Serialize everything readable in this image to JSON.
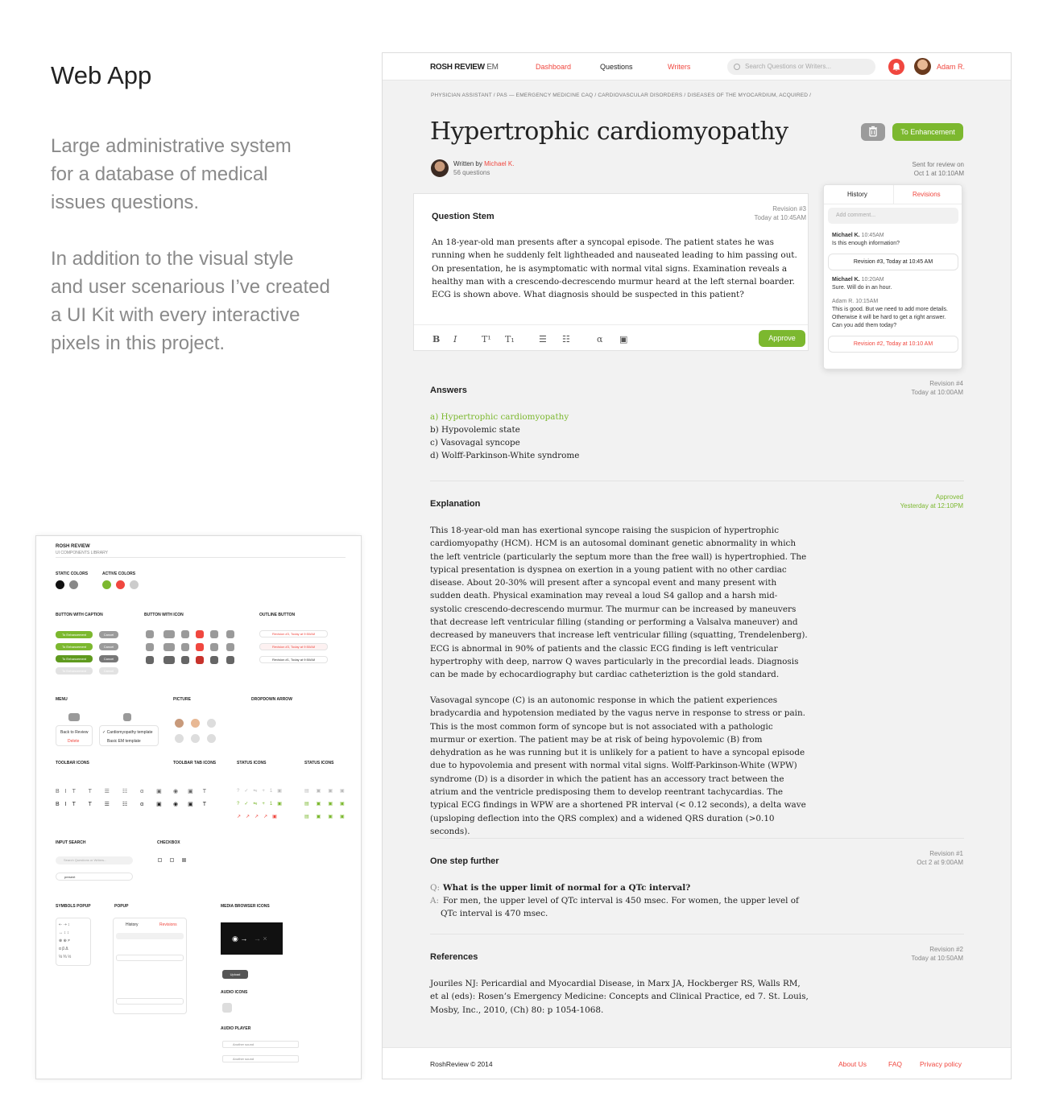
{
  "left": {
    "title": "Web App",
    "para1": "Large administrative system\nfor a database of medical\nissues questions.",
    "para2": "In addition to the visual style\nand user scenarious I’ve created\na UI Kit with every interactive\npixels in this project."
  },
  "uikit": {
    "title": "ROSH REVIEW",
    "subtitle": "UI COMPONENTS LIBRARY",
    "sections": [
      "STATIC COLORS",
      "ACTIVE COLORS",
      "BUTTON WITH CAPTION",
      "BUTTON WITH ICON",
      "OUTLINE BUTTON",
      "MENU",
      "PICTURE",
      "DROPDOWN ARROW",
      "TOOLBAR ICONS",
      "TOOLBAR TAB ICONS",
      "STATUS ICONS",
      "STATUS ICONS",
      "INPUT SEARCH",
      "CHECKBOX",
      "SYMBOLS POPUP",
      "POPUP",
      "MEDIA BROWSER ICONS",
      "AUDIO ICONS",
      "AUDIO PLAYER"
    ],
    "btn_enh": "To Enhancement",
    "btn_cancel": "Cancel",
    "outline1": "Revision #3, Today at 9:50AM",
    "outline2": "Revision #1, Today at 9:50AM",
    "menu_item1": "Back to Review",
    "menu_item2": "Delete",
    "menu_item3": "✓ Cardiomyopathy template",
    "menu_item4": "Basic EM template",
    "search_placeholder": "Search Questions or Writers...",
    "search_value": "present",
    "upload": "Upload",
    "audio1": "Another sound",
    "audio2": "Another sound",
    "popup_tab1": "History",
    "popup_tab2": "Revisions",
    "static_colors": [
      "#111111",
      "#888888"
    ],
    "active_colors": [
      "#7cb82f",
      "#f0473f",
      "#cccccc"
    ]
  },
  "app": {
    "logo": "ROSH REVIEW",
    "logo_suffix": "EM",
    "nav": [
      "Dashboard",
      "Questions",
      "Writers"
    ],
    "search_placeholder": "Search Questions or Writers...",
    "user": "Adam R.",
    "breadcrumb": "PHYSICIAN ASSISTANT  /  PAS — EMERGENCY MEDICINE CAQ  /  CARDIOVASCULAR DISORDERS  /  DISEASES OF THE MYOCARDIUM, ACQUIRED  /",
    "title": "Hypertrophic cardiomyopathy",
    "enhancement_button": "To Enhancement",
    "written_by": "Written by",
    "author": "Michael K.",
    "question_count": "56 questions",
    "sent_for_review_1": "Sent for review on",
    "sent_for_review_2": "Oct 1 at 10:10AM",
    "stem": {
      "title": "Question Stem",
      "revision": "Revision #3",
      "revision_time": "Today at 10:45AM",
      "text": "An 18-year-old man presents after a syncopal episode. The patient states he was running when he suddenly felt lightheaded and nauseated leading to him passing out. On presentation, he is asymptomatic with normal vital signs. Examination reveals a healthy man with a crescendo-decrescendo murmur heard at the left sternal boarder. ECG is shown above. What diagnosis should be suspected in this patient?",
      "approve": "Approve",
      "toolbar": [
        "B",
        "I",
        "T¹",
        "T₁",
        "☰",
        "☷",
        "α",
        "▣"
      ]
    },
    "history": {
      "tab_history": "History",
      "tab_revisions": "Revisions",
      "add_comment": "Add comment...",
      "comments": [
        {
          "author": "Michael K.",
          "time": "10:45AM",
          "text": "Is this enough information?"
        },
        {
          "author": "Michael K.",
          "time": "10:20AM",
          "text": "Sure. Will do in an hour."
        },
        {
          "author": "Adam R.",
          "time": "10:15AM",
          "text": "This is good. But we need to add more details. Otherwise it will be hard to get a right answer. Can you add them today?"
        }
      ],
      "revision_3": "Revision #3, Today at 10:45 AM",
      "revision_2": "Revision #2, Today at 10:10 AM"
    },
    "answers": {
      "title": "Answers",
      "revision": "Revision #4",
      "revision_time": "Today at 10:00AM",
      "items": [
        "a) Hypertrophic cardiomyopathy",
        "b) Hypovolemic state",
        "c) Vasovagal syncope",
        "d) Wolff-Parkinson-White syndrome"
      ]
    },
    "explanation": {
      "title": "Explanation",
      "status": "Approved",
      "status_time": "Yesterday at 12:10PM",
      "p1": "This 18-year-old man has exertional syncope raising the suspicion of hypertrophic cardiomyopathy (HCM). HCM is an autosomal dominant genetic abnormality in which the left ventricle (particularly the septum more than the free wall) is hypertrophied. The typical presentation is dyspnea on exertion in a young patient with no other cardiac disease. About 20-30% will present after a syncopal event and many present with sudden death. Physical examination may reveal a loud S4 gallop and a harsh mid-systolic crescendo-decrescendo murmur. The murmur can be increased by maneuvers that decrease left ventricular filling (standing or performing a Valsalva maneuver) and decreased by maneuvers that increase left ventricular filling (squatting, Trendelenberg). ECG is abnormal in 90% of patients and the classic ECG finding is left ventricular hypertrophy with deep, narrow Q waves particularly in the precordial leads. Diagnosis can be made by echocardiography but cardiac catheteriztion is the gold standard.",
      "p2": "Vasovagal syncope (C) is an autonomic response in which the patient experiences bradycardia and hypotension mediated by the vagus nerve in response to stress or pain. This is the most common form of syncope but is not associated with a pathologic murmur or exertion. The patient may be at risk of being hypovolemic (B) from dehydration as he was running but it is unlikely for a patient to have a syncopal episode due to hypovolemia and present with normal vital signs. Wolff-Parkinson-White (WPW) syndrome (D) is a disorder in which the patient has an accessory tract between the atrium and the ventricle predisposing them to develop reentrant tachycardias. The typical ECG findings in WPW are a shortened PR interval (< 0.12 seconds), a delta wave (upsloping deflection into the QRS complex) and a widened QRS duration (>0.10 seconds)."
    },
    "further": {
      "title": "One step further",
      "revision": "Revision #1",
      "revision_time": "Oct 2 at 9:00AM",
      "q_label": "Q:",
      "question": "What is the upper limit of normal for a QTc interval?",
      "a_label": "A:",
      "answer": "For men, the upper level of QTc interval is 450 msec. For women, the upper level  of QTc interval is 470 msec."
    },
    "references": {
      "title": "References",
      "revision": "Revision #2",
      "revision_time": "Today at 10:50AM",
      "text": "Jouriles NJ: Pericardial and Myocardial Disease, in Marx JA, Hockberger RS, Walls RM, et al (eds): Rosen’s Emergency Medicine: Concepts and Clinical Practice, ed 7. St. Louis, Mosby, Inc., 2010, (Ch) 80: p 1054-1068."
    },
    "footer": {
      "copyright": "RoshReview © 2014",
      "links": [
        "About Us",
        "FAQ",
        "Privacy policy"
      ]
    },
    "colors": {
      "green": "#7cb82f",
      "red": "#f0473f",
      "grey": "#9b9b9b"
    }
  }
}
